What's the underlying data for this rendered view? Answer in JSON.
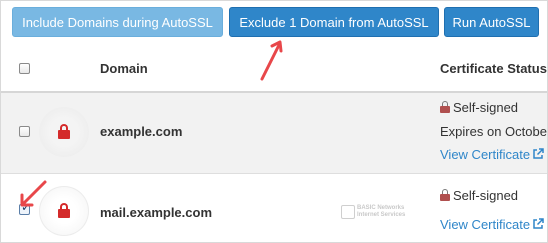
{
  "toolbar": {
    "include_label": "Include Domains during AutoSSL",
    "exclude_label": "Exclude 1 Domain from AutoSSL",
    "run_label": "Run AutoSSL"
  },
  "table": {
    "columns": [
      "Domain",
      "Certificate Status"
    ],
    "rows": [
      {
        "domain": "example.com",
        "checked": false,
        "status": "Self-signed",
        "expires": "Expires on October",
        "link": "View Certificate"
      },
      {
        "domain": "mail.example.com",
        "checked": true,
        "status": "Self-signed",
        "link": "View Certificate"
      }
    ]
  },
  "watermark": {
    "line1": "BASIC Networks",
    "line2": "Internet Services"
  },
  "colors": {
    "primary_button": "#2f86c9",
    "disabled_button": "#79b8e3",
    "link": "#2f86c9",
    "lock_red": "#d42a2a",
    "annotation_arrow": "#e8474a"
  },
  "icons": [
    "lock-icon",
    "external-link-icon",
    "checkbox",
    "annotation-arrow"
  ]
}
